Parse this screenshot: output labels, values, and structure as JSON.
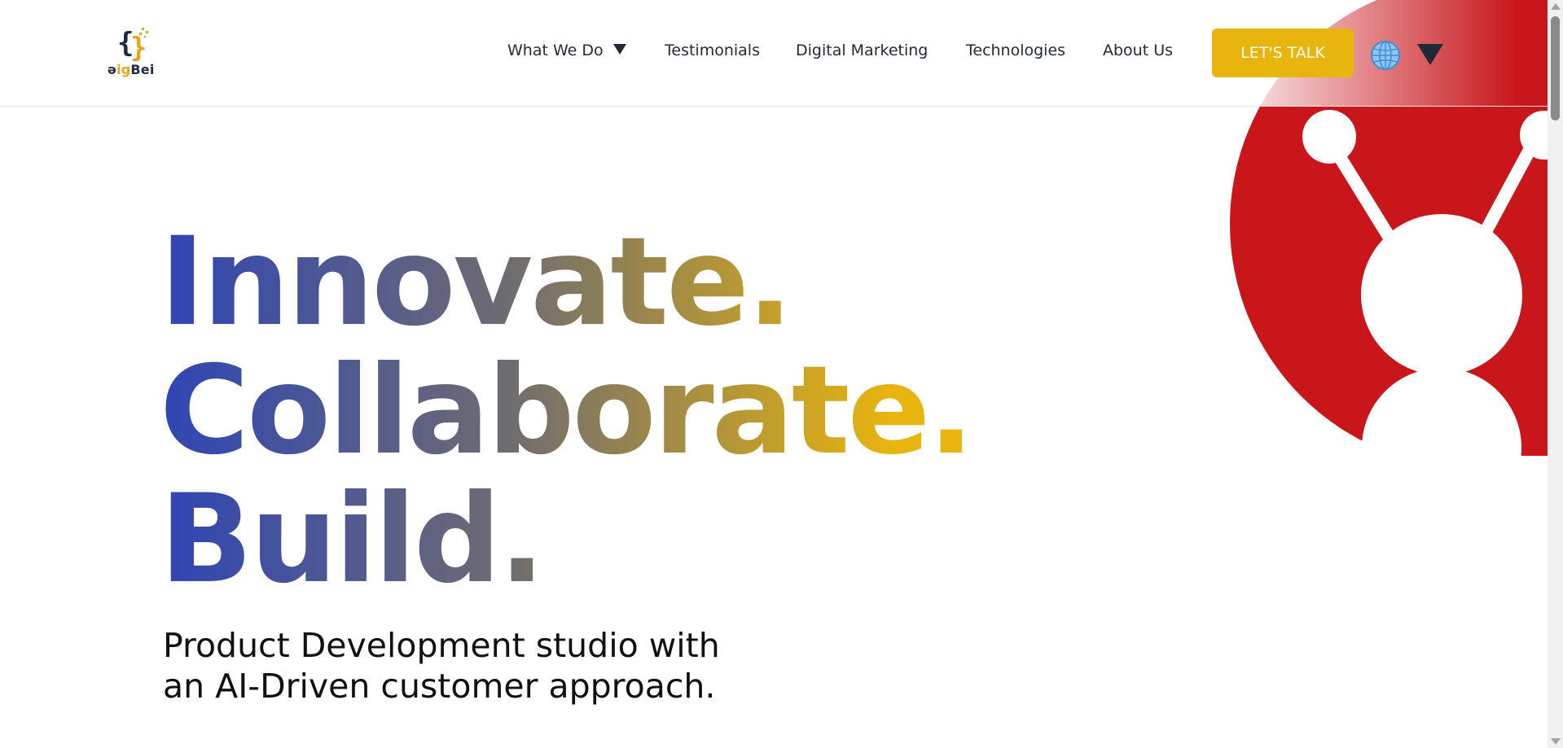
{
  "header": {
    "logo_text_prefix": "ə",
    "logo_text_accent": "ig",
    "logo_text_suffix": "Bei",
    "nav": [
      {
        "label": "What We Do"
      },
      {
        "label": "Testimonials"
      },
      {
        "label": "Digital Marketing"
      },
      {
        "label": "Technologies"
      },
      {
        "label": "About Us"
      }
    ],
    "cta_label": "LET'S TALK",
    "language_icon": "globe-icon"
  },
  "hero": {
    "headline": [
      "Innovate.",
      "Collaborate.",
      "Build."
    ],
    "subheading_line1": "Product Development studio with",
    "subheading_line2": "an AI-Driven customer approach."
  },
  "colors": {
    "brand_blue": "#2f45b5",
    "brand_gold": "#e8b50e",
    "graphic_red": "#c8161b",
    "text_dark": "#1f2937"
  }
}
